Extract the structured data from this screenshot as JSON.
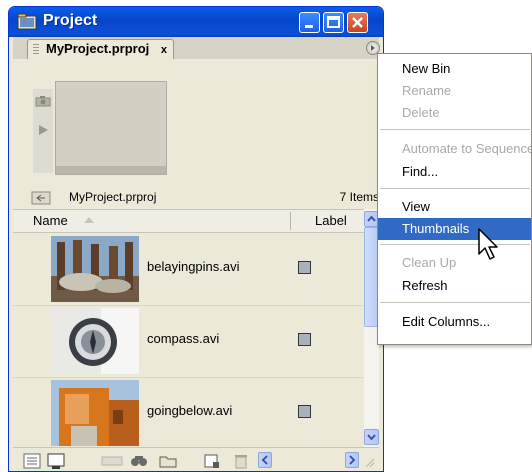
{
  "window": {
    "title": "Project"
  },
  "tab": {
    "label": "MyProject.prproj",
    "close_glyph": "x"
  },
  "folder": {
    "name": "MyProject.prproj",
    "count": "7 Items"
  },
  "columns": {
    "name": "Name",
    "label": "Label"
  },
  "rows": [
    {
      "name": "belayingpins.avi",
      "label_color": "#a8b2b8"
    },
    {
      "name": "compass.avi",
      "label_color": "#a8b2b8"
    },
    {
      "name": "goingbelow.avi",
      "label_color": "#a8b2b8"
    }
  ],
  "menu": {
    "items": [
      {
        "label": "New Bin",
        "enabled": true
      },
      {
        "label": "Rename",
        "enabled": false
      },
      {
        "label": "Delete",
        "enabled": false
      },
      {
        "label": "Automate to Sequence...",
        "enabled": false
      },
      {
        "label": "Find...",
        "enabled": true
      },
      {
        "label": "View",
        "enabled": true
      },
      {
        "label": "Thumbnails",
        "enabled": true,
        "selected": true
      },
      {
        "label": "Clean Up",
        "enabled": false
      },
      {
        "label": "Refresh",
        "enabled": true
      },
      {
        "label": "Edit Columns...",
        "enabled": true
      }
    ]
  },
  "colors": {
    "title_bar": "#0a5ee8",
    "selection": "#316ac5"
  }
}
